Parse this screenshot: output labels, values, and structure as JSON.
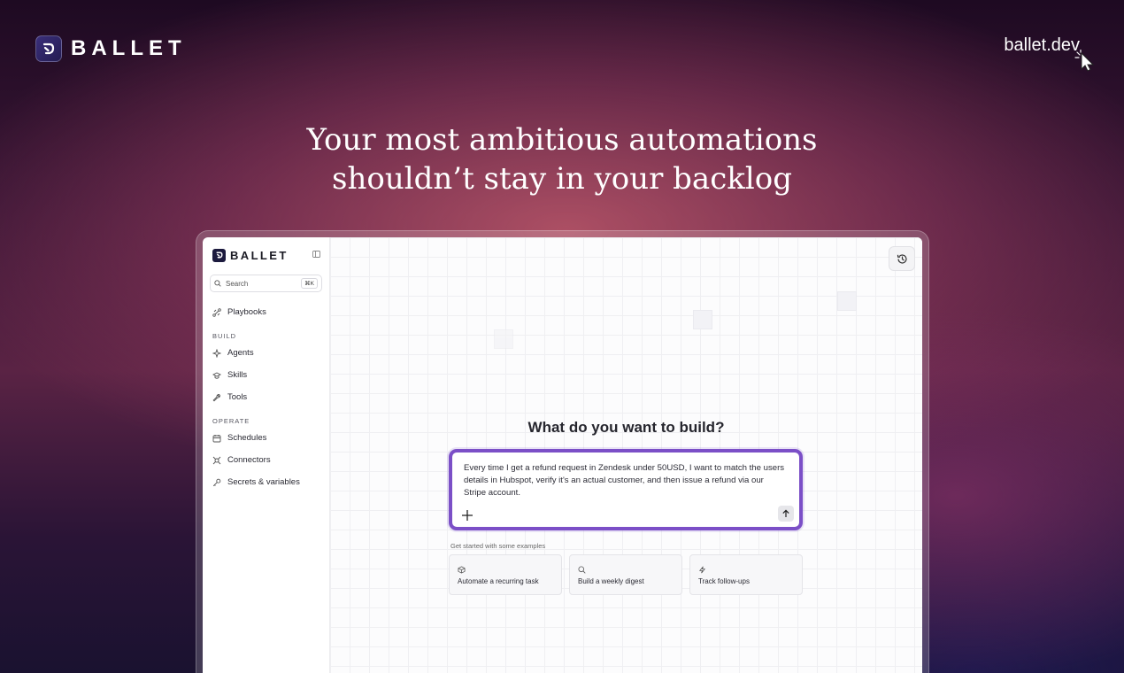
{
  "brand": {
    "name": "BALLET",
    "site": "ballet.dev"
  },
  "headline": {
    "line1": "Your most ambitious automations",
    "line2": "shouldn’t stay in your backlog"
  },
  "app": {
    "sidebar": {
      "brand": "BALLET",
      "search": {
        "placeholder": "Search",
        "shortcut": "⌘K"
      },
      "top_items": [
        {
          "label": "Playbooks",
          "icon": "playbooks-icon"
        }
      ],
      "groups": [
        {
          "title": "BUILD",
          "items": [
            {
              "label": "Agents",
              "icon": "agents-icon"
            },
            {
              "label": "Skills",
              "icon": "skills-icon"
            },
            {
              "label": "Tools",
              "icon": "tools-icon"
            }
          ]
        },
        {
          "title": "OPERATE",
          "items": [
            {
              "label": "Schedules",
              "icon": "calendar-icon"
            },
            {
              "label": "Connectors",
              "icon": "connectors-icon"
            },
            {
              "label": "Secrets & variables",
              "icon": "key-icon"
            }
          ]
        }
      ]
    },
    "main": {
      "title": "What do you want to build?",
      "prompt": "Every time I get a refund request in Zendesk under 50USD, I want to match the users details in Hubspot, verify it's an actual customer, and then issue a refund via our Stripe account.",
      "examples_label": "Get started with some examples",
      "examples": [
        {
          "label": "Automate a recurring task",
          "icon": "cube-icon"
        },
        {
          "label": "Build a weekly digest",
          "icon": "search-icon"
        },
        {
          "label": "Track follow-ups",
          "icon": "bolt-icon"
        }
      ]
    }
  },
  "colors": {
    "accent": "#7b4fc7",
    "brand_dark": "#1c1a3e"
  }
}
